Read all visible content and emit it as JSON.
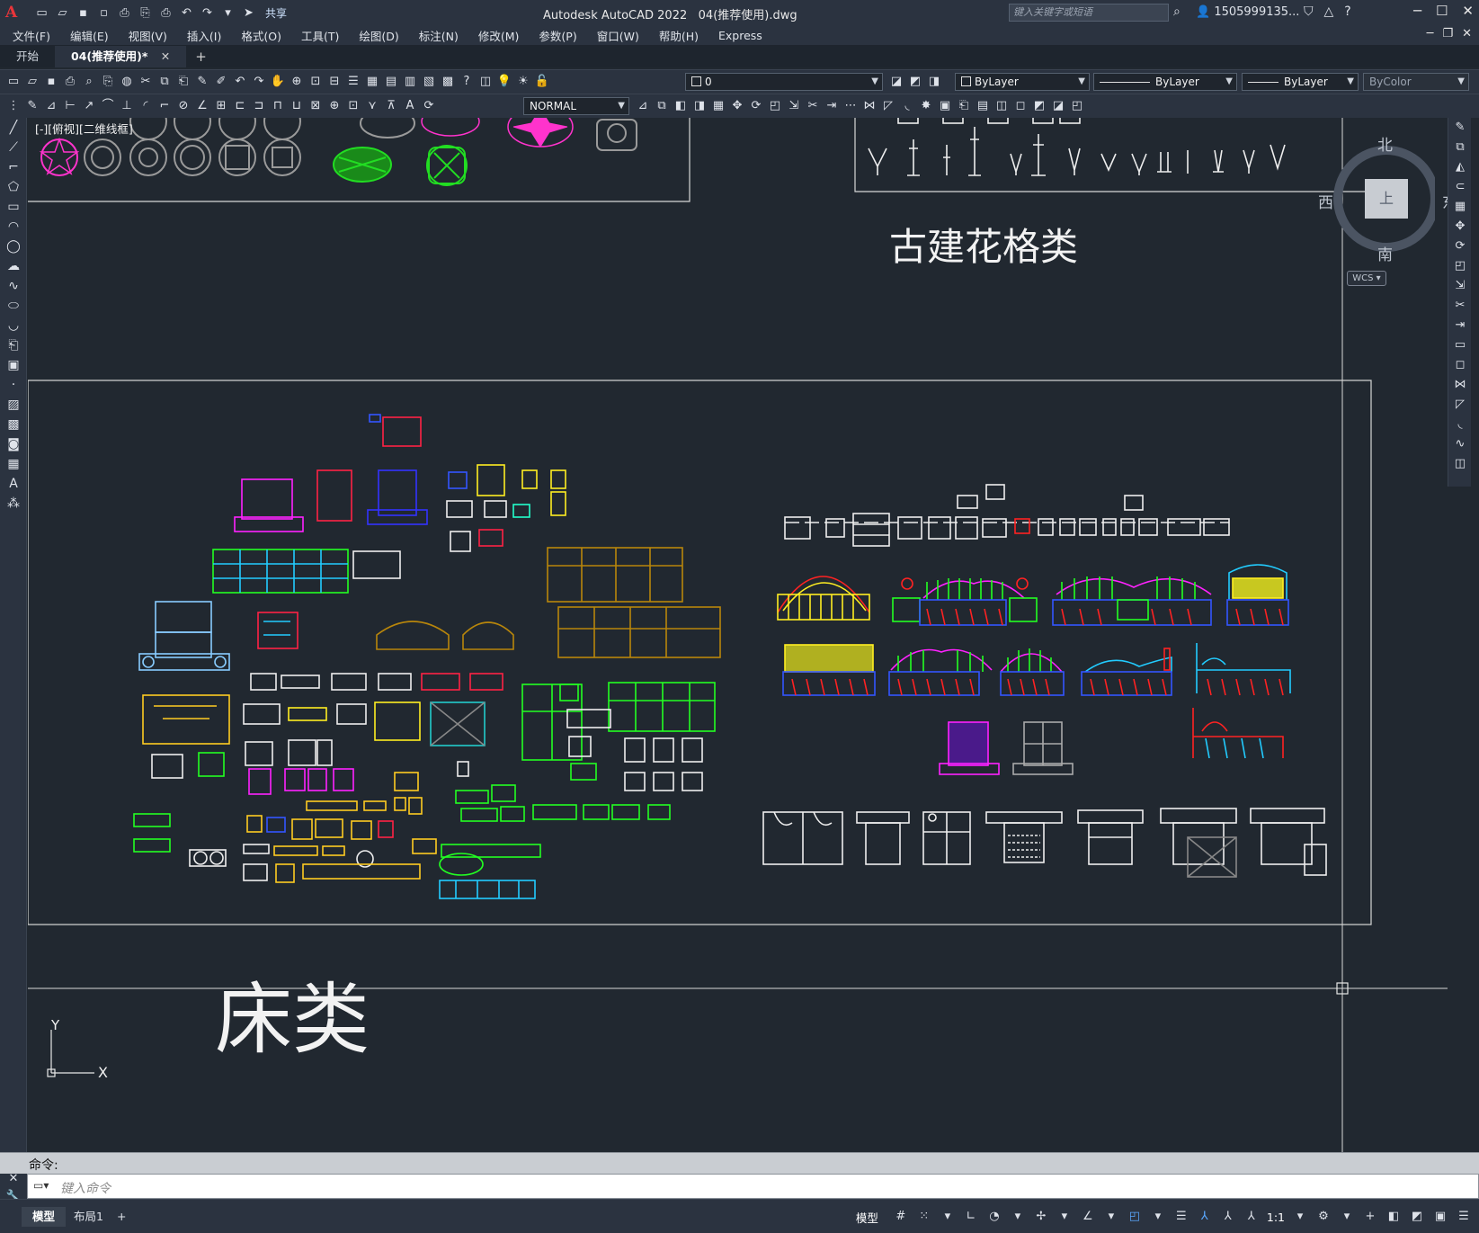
{
  "titlebar": {
    "app_title": "Autodesk AutoCAD 2022",
    "file_name": "04(推荐使用).dwg",
    "share_label": "共享",
    "search_placeholder": "键入关键字或短语",
    "user_name": "1505999135..."
  },
  "menu": [
    "文件(F)",
    "编辑(E)",
    "视图(V)",
    "插入(I)",
    "格式(O)",
    "工具(T)",
    "绘图(D)",
    "标注(N)",
    "修改(M)",
    "参数(P)",
    "窗口(W)",
    "帮助(H)",
    "Express"
  ],
  "tabs": {
    "start": "开始",
    "active": "04(推荐使用)*",
    "close": "✕",
    "add": "+"
  },
  "toolbar": {
    "layer_value": "0",
    "color_value": "ByLayer",
    "linetype_value": "ByLayer",
    "lineweight_value": "ByLayer",
    "plotstyle_value": "ByColor",
    "dimstyle_value": "NORMAL"
  },
  "viewport": {
    "control_label": "[-][俯视][二维线框]"
  },
  "drawing": {
    "label_ancient": "古建花格类",
    "label_beds": "床类"
  },
  "viewcube": {
    "north": "北",
    "south": "南",
    "east": "东",
    "west": "西",
    "top_face": "上",
    "wcs": "WCS"
  },
  "ucs": {
    "x": "X",
    "y": "Y"
  },
  "command": {
    "history_label": "命令:",
    "input_placeholder": "键入命令"
  },
  "statusbar": {
    "model_tab": "模型",
    "layout_tab": "布局1",
    "add_tab": "+",
    "model_label": "模型",
    "scale": "1:1"
  }
}
